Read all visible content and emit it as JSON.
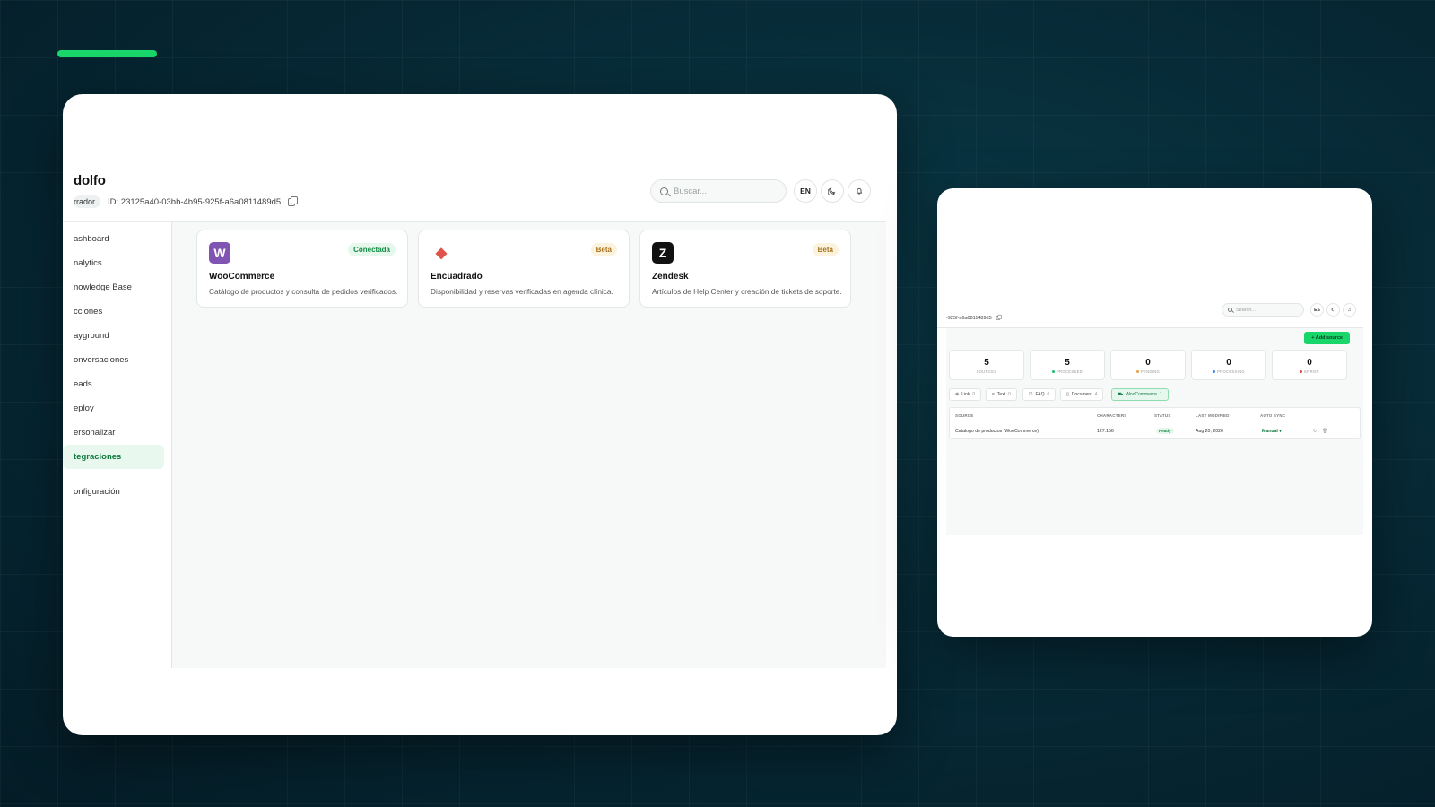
{
  "left_window": {
    "title": "dolfo",
    "role": "rrador",
    "id_text": "ID: 23125a40-03bb-4b95-925f-a6a0811489d5",
    "search_placeholder": "Buscar...",
    "lang_label": "EN",
    "nav": [
      {
        "label": "ashboard",
        "icon": "dashboard-icon"
      },
      {
        "label": "nalytics",
        "icon": "analytics-icon"
      },
      {
        "label": "nowledge Base",
        "icon": "knowledge-icon"
      },
      {
        "label": "cciones",
        "icon": "actions-icon"
      },
      {
        "label": "ayground",
        "icon": "playground-icon"
      },
      {
        "label": "onversaciones",
        "icon": "chat-icon"
      },
      {
        "label": "eads",
        "icon": "leads-icon"
      },
      {
        "label": "eploy",
        "icon": "deploy-icon"
      },
      {
        "label": "ersonalizar",
        "icon": "customize-icon"
      },
      {
        "label": "tegraciones",
        "icon": "integrations-icon",
        "active": true
      },
      {
        "label": "onfiguración",
        "icon": "settings-icon"
      }
    ],
    "integrations": [
      {
        "name": "WooCommerce",
        "badge": "Conectada",
        "desc": "Catálogo de productos y consulta de pedidos verificados.",
        "logo_color": "#7f54b3",
        "logo_glyph": "W"
      },
      {
        "name": "Encuadrado",
        "badge": "Beta",
        "desc": "Disponibilidad y reservas verificadas en agenda clínica.",
        "logo_color": "#e0534a",
        "logo_glyph": "◆"
      },
      {
        "name": "Zendesk",
        "badge": "Beta",
        "desc": "Artículos de Help Center y creación de tickets de soporte.",
        "logo_color": "#111111",
        "logo_glyph": "Z"
      }
    ]
  },
  "right_window": {
    "id_text": "-925f-a6a0811489d5",
    "search_placeholder": "Search...",
    "lang_label": "ES",
    "add_source_label": "+ Add source",
    "stats": [
      {
        "value": "5",
        "label": "SOURCES",
        "dot": ""
      },
      {
        "value": "5",
        "label": "PROCESSED",
        "dot": "#19c36a"
      },
      {
        "value": "0",
        "label": "PENDING",
        "dot": "#e8a23c"
      },
      {
        "value": "0",
        "label": "PROCESSING",
        "dot": "#3b82f6"
      },
      {
        "value": "0",
        "label": "ERROR",
        "dot": "#e34b4b"
      }
    ],
    "filters": [
      {
        "label": "Link",
        "count": "0",
        "icon": "globe-icon"
      },
      {
        "label": "Text",
        "count": "0",
        "icon": "text-icon"
      },
      {
        "label": "FAQ",
        "count": "0",
        "icon": "faq-icon"
      },
      {
        "label": "Document",
        "count": "4",
        "icon": "document-icon"
      },
      {
        "label": "WooCommerce",
        "count": "1",
        "icon": "cart-icon",
        "active": true
      }
    ],
    "table": {
      "headers": [
        "SOURCE",
        "CHARACTERS",
        "STATUS",
        "LAST MODIFIED",
        "AUTO SYNC"
      ],
      "row": {
        "source": "Catalogo de productos (WooCommerce)",
        "characters": "127.156",
        "status": "Ready",
        "modified": "Aug 20, 2026",
        "sync": "Manual ▾"
      }
    }
  },
  "colors": {
    "accent": "#19d66b",
    "background": "#062a36"
  }
}
